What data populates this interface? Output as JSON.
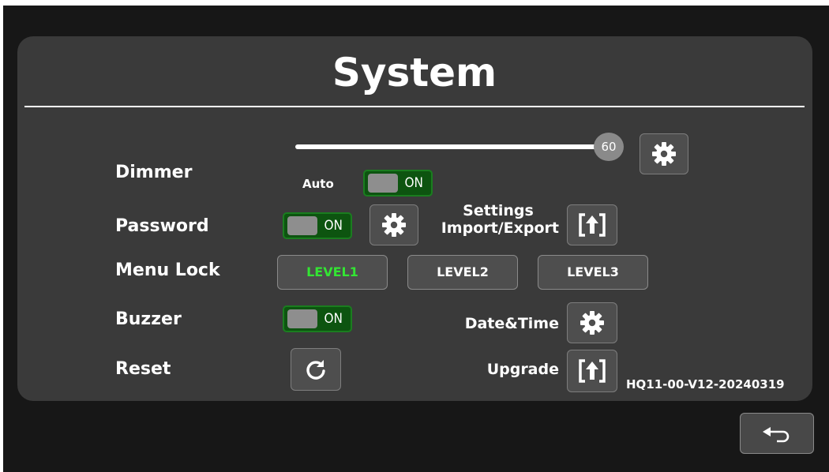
{
  "title": "System",
  "dimmer": {
    "label": "Dimmer",
    "value": "60",
    "slider_fraction": 0.97,
    "auto_label": "Auto",
    "auto_toggle": "ON",
    "settings_icon": "gear-icon"
  },
  "password": {
    "label": "Password",
    "toggle": "ON",
    "settings_icon": "gear-icon"
  },
  "settings_import_export": {
    "label_line1": "Settings",
    "label_line2": "Import/Export",
    "icon": "upload-icon"
  },
  "menu_lock": {
    "label": "Menu Lock",
    "levels": [
      "LEVEL1",
      "LEVEL2",
      "LEVEL3"
    ],
    "active_level": "LEVEL1",
    "active_color": "#33e533"
  },
  "buzzer": {
    "label": "Buzzer",
    "toggle": "ON"
  },
  "date_time": {
    "label": "Date&Time",
    "icon": "gear-icon"
  },
  "reset": {
    "label": "Reset",
    "icon": "refresh-icon"
  },
  "upgrade": {
    "label": "Upgrade",
    "icon": "upload-icon"
  },
  "version": "HQ11-00-V12-20240319",
  "back_button": {
    "icon": "back-arrow-icon"
  },
  "colors": {
    "panel": "#3a3a3a",
    "background": "#171717",
    "toggle_on": "#0d5410"
  }
}
